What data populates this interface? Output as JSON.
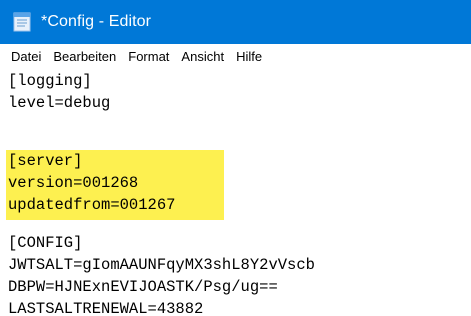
{
  "window": {
    "title": "*Config - Editor",
    "icon": "notepad-icon"
  },
  "menu": {
    "items": [
      "Datei",
      "Bearbeiten",
      "Format",
      "Ansicht",
      "Hilfe"
    ]
  },
  "editor": {
    "lines": [
      "[logging]",
      "level=debug",
      "",
      "[server]",
      "version=001268",
      "updatedfrom=001267",
      "",
      "[CONFIG]",
      "JWTSALT=gIomAAUNFqyMX3shL8Y2vVscb",
      "DBPW=HJNExnEVIJOASTK/Psg/ug==",
      "LASTSALTRENEWAL=43882"
    ],
    "highlight_color": "#fdf050"
  },
  "colors": {
    "titlebar": "#0078d7",
    "title_text": "#ffffff"
  }
}
